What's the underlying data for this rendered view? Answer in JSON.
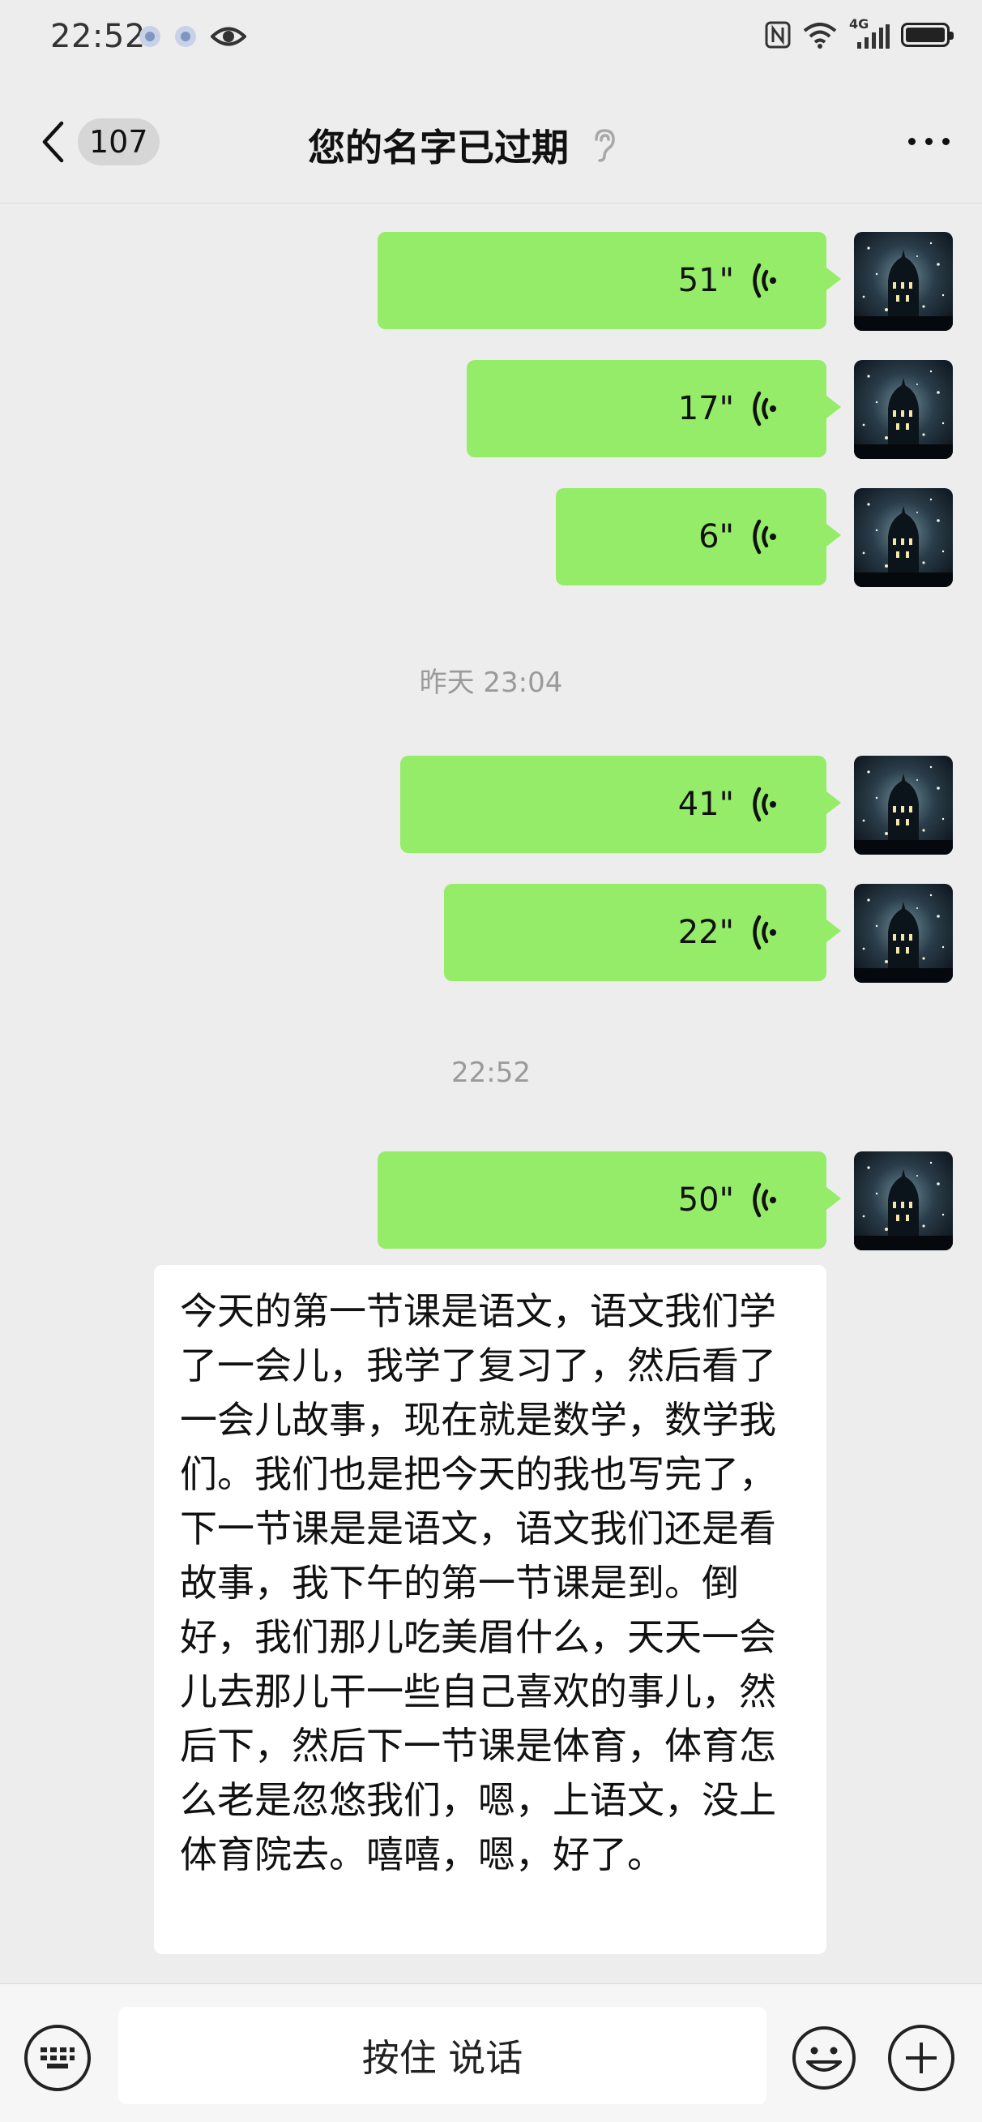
{
  "status_bar": {
    "time": "22:52",
    "network": "4G",
    "icons": [
      "app-notification-icon",
      "app-notification-icon",
      "eye-icon",
      "nfc-icon",
      "wifi-icon",
      "signal-icon",
      "battery-icon"
    ]
  },
  "header": {
    "back_icon": "chevron-left-icon",
    "unread_count": "107",
    "title": "您的名字已过期",
    "ear_icon": "earpiece-mode-icon",
    "more_icon": "more-dots-icon"
  },
  "messages": [
    {
      "type": "voice",
      "sender": "self",
      "duration": "51\""
    },
    {
      "type": "voice",
      "sender": "self",
      "duration": "17\""
    },
    {
      "type": "voice",
      "sender": "self",
      "duration": "6\""
    },
    {
      "type": "timestamp",
      "text": "昨天 23:04"
    },
    {
      "type": "voice",
      "sender": "self",
      "duration": "41\""
    },
    {
      "type": "voice",
      "sender": "self",
      "duration": "22\""
    },
    {
      "type": "timestamp",
      "text": "22:52"
    },
    {
      "type": "voice",
      "sender": "self",
      "duration": "50\""
    },
    {
      "type": "transcript",
      "text": "今天的第一节课是语文，语文我们学了一会儿，我学了复习了，然后看了一会儿故事，现在就是数学，数学我们。我们也是把今天的我也写完了，下一节课是是语文，语文我们还是看故事，我下午的第一节课是到。倒好，我们那儿吃美眉什么，天天一会儿去那儿干一些自己喜欢的事儿，然后下，然后下一节课是体育，体育怎么老是忽悠我们，嗯，上语文，没上体育院去。嘻嘻，嗯，好了。"
    }
  ],
  "input_bar": {
    "keyboard_icon": "keyboard-icon",
    "hold_to_talk": "按住 说话",
    "emoji_icon": "emoji-icon",
    "plus_icon": "plus-icon"
  },
  "colors": {
    "background": "#ededed",
    "voice_bubble": "#95ec69",
    "transcript_bubble": "#ffffff",
    "timestamp_text": "#9a9a9a"
  }
}
